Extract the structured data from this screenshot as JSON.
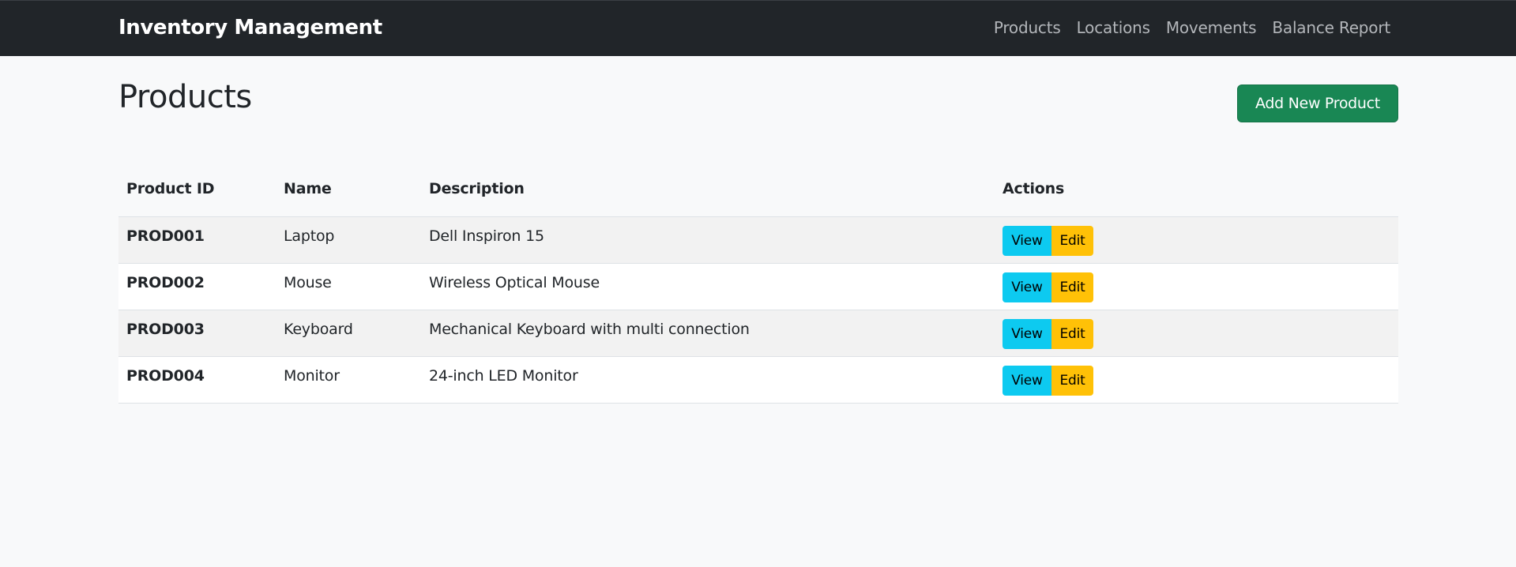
{
  "navbar": {
    "brand": "Inventory Management",
    "links": [
      {
        "label": "Products"
      },
      {
        "label": "Locations"
      },
      {
        "label": "Movements"
      },
      {
        "label": "Balance Report"
      }
    ]
  },
  "page": {
    "title": "Products",
    "add_button_label": "Add New Product"
  },
  "table": {
    "headers": {
      "id": "Product ID",
      "name": "Name",
      "description": "Description",
      "actions": "Actions"
    },
    "rows": [
      {
        "id": "PROD001",
        "name": "Laptop",
        "description": "Dell Inspiron 15"
      },
      {
        "id": "PROD002",
        "name": "Mouse",
        "description": "Wireless Optical Mouse"
      },
      {
        "id": "PROD003",
        "name": "Keyboard",
        "description": "Mechanical Keyboard with multi connection"
      },
      {
        "id": "PROD004",
        "name": "Monitor",
        "description": "24-inch LED Monitor"
      }
    ],
    "view_label": "View",
    "edit_label": "Edit"
  },
  "colors": {
    "navbar_bg": "#212529",
    "primary_success": "#198754",
    "info": "#0dcaf0",
    "warning": "#ffc107",
    "page_bg": "#f8f9fa"
  }
}
